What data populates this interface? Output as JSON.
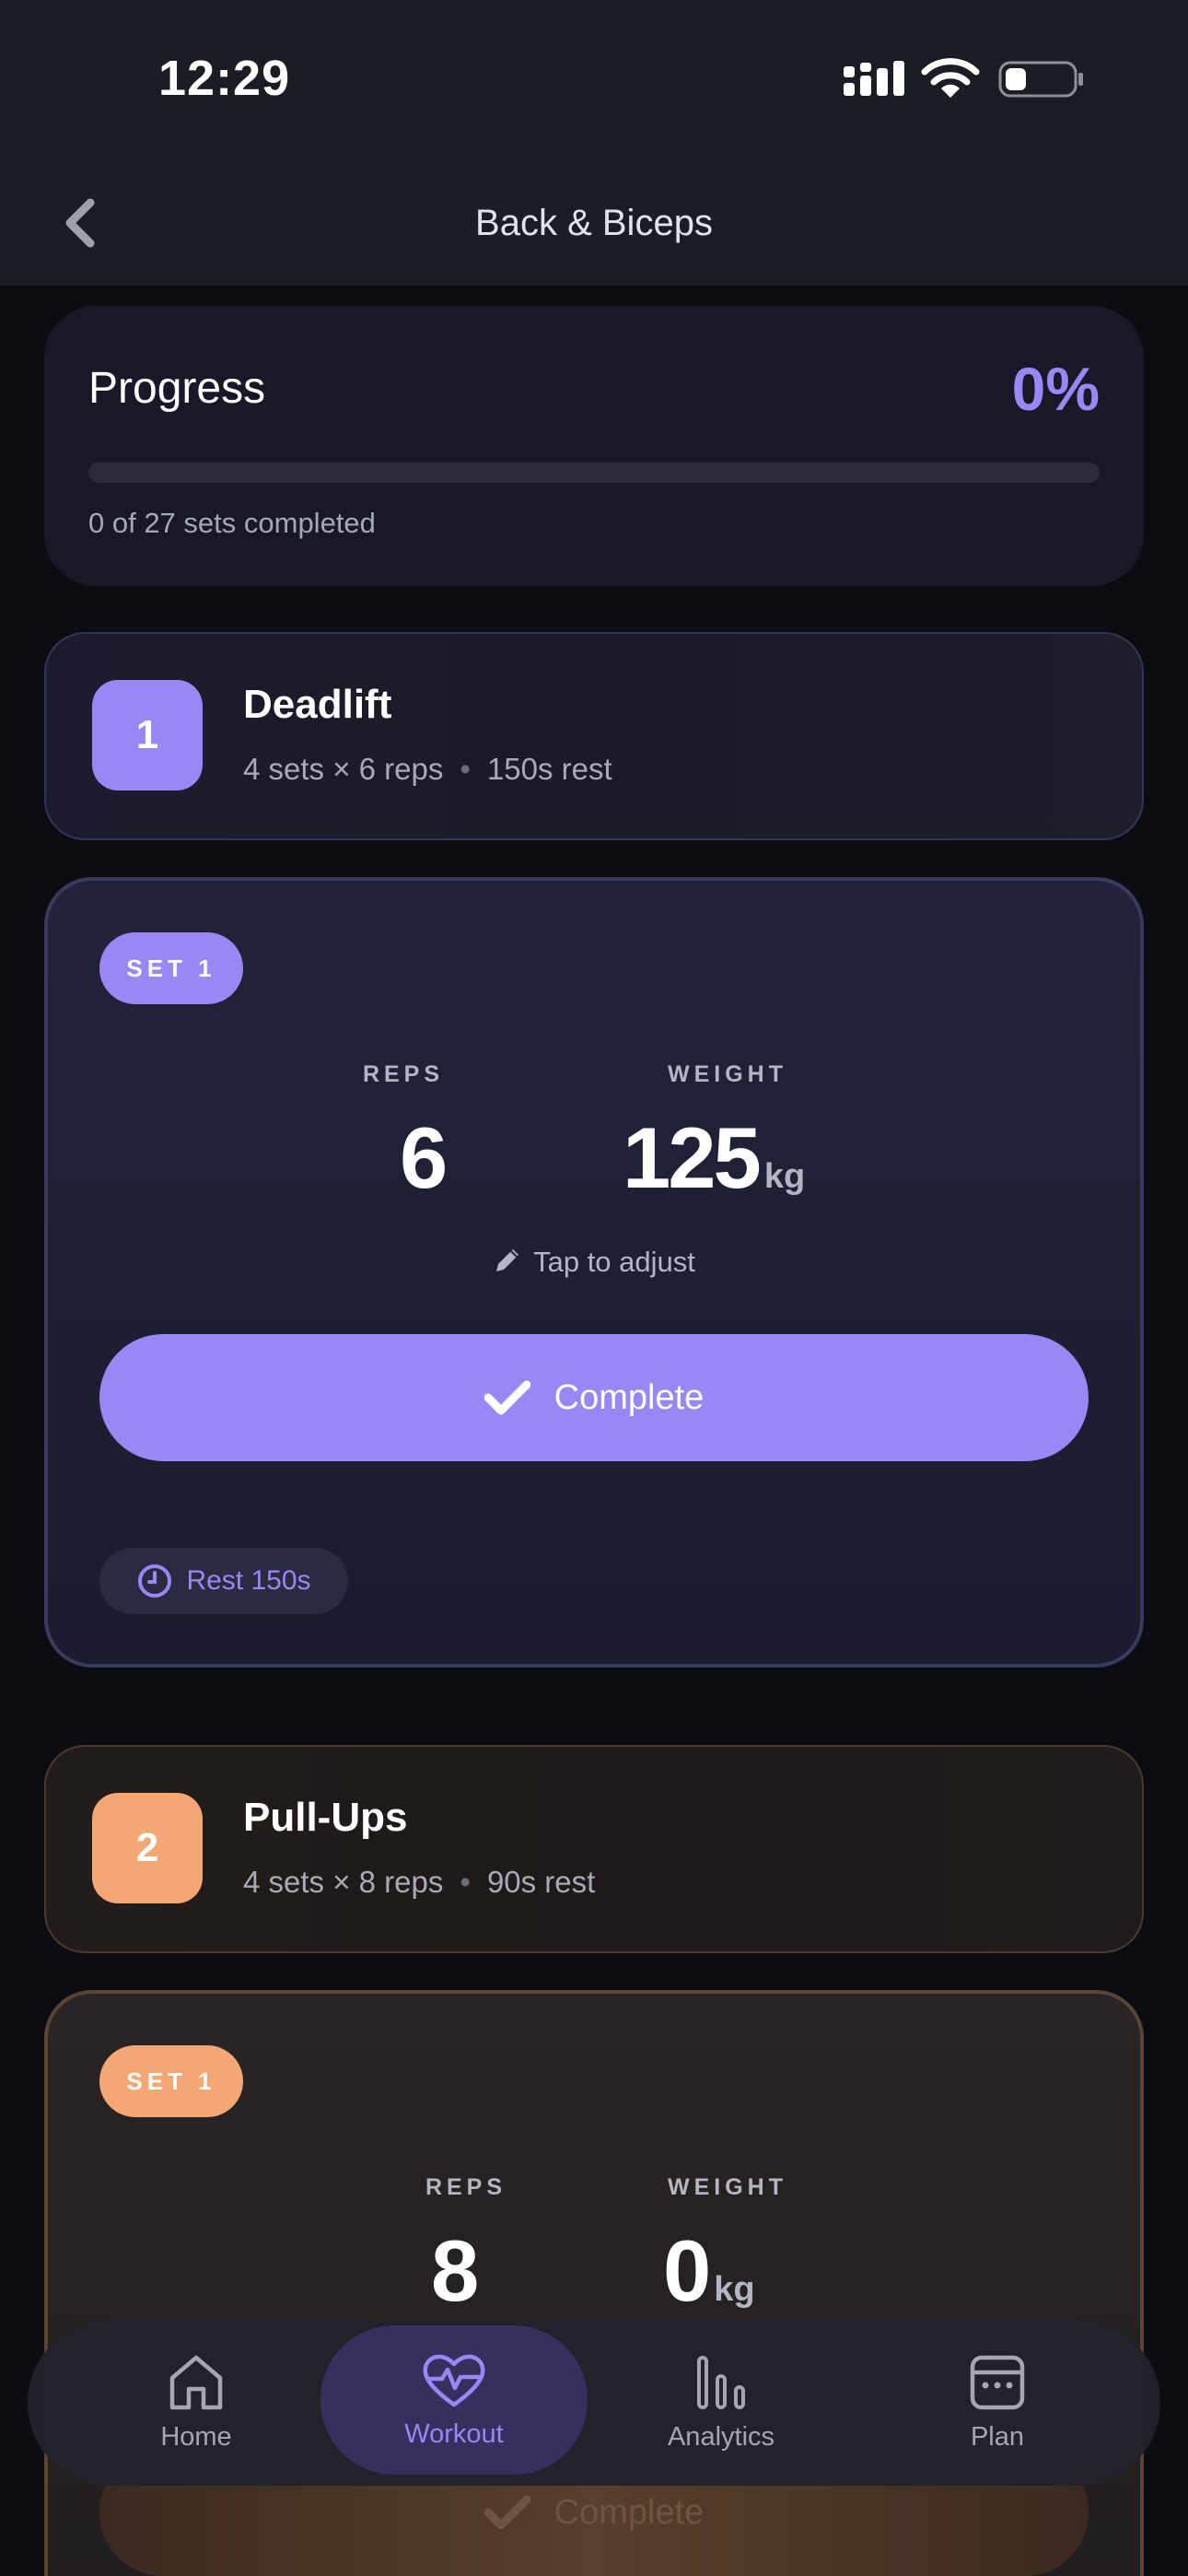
{
  "status_bar": {
    "time": "12:29"
  },
  "header": {
    "title": "Back & Biceps"
  },
  "progress": {
    "title": "Progress",
    "percent_label": "0%",
    "fraction": 0,
    "summary": "0 of 27 sets completed"
  },
  "exercises": [
    {
      "number": "1",
      "name": "Deadlift",
      "sets_reps": "4 sets × 6 reps",
      "rest": "150s rest",
      "accent_color": "#9a86f5",
      "current_set": {
        "badge": "SET 1",
        "reps_label": "REPS",
        "reps_value": "6",
        "weight_label": "WEIGHT",
        "weight_value": "125",
        "weight_unit": "kg",
        "adjust_hint": "Tap to adjust",
        "complete_label": "Complete",
        "rest_label": "Rest 150s"
      }
    },
    {
      "number": "2",
      "name": "Pull-Ups",
      "sets_reps": "4 sets × 8 reps",
      "rest": "90s rest",
      "accent_color": "#f3a874",
      "current_set": {
        "badge": "SET 1",
        "reps_label": "REPS",
        "reps_value": "8",
        "weight_label": "WEIGHT",
        "weight_value": "0",
        "weight_unit": "kg",
        "complete_label": "Complete"
      }
    }
  ],
  "tabbar": {
    "items": [
      {
        "label": "Home",
        "icon": "home-icon"
      },
      {
        "label": "Workout",
        "icon": "heart-pulse-icon",
        "active": true
      },
      {
        "label": "Analytics",
        "icon": "bar-chart-icon"
      },
      {
        "label": "Plan",
        "icon": "calendar-icon"
      }
    ]
  }
}
